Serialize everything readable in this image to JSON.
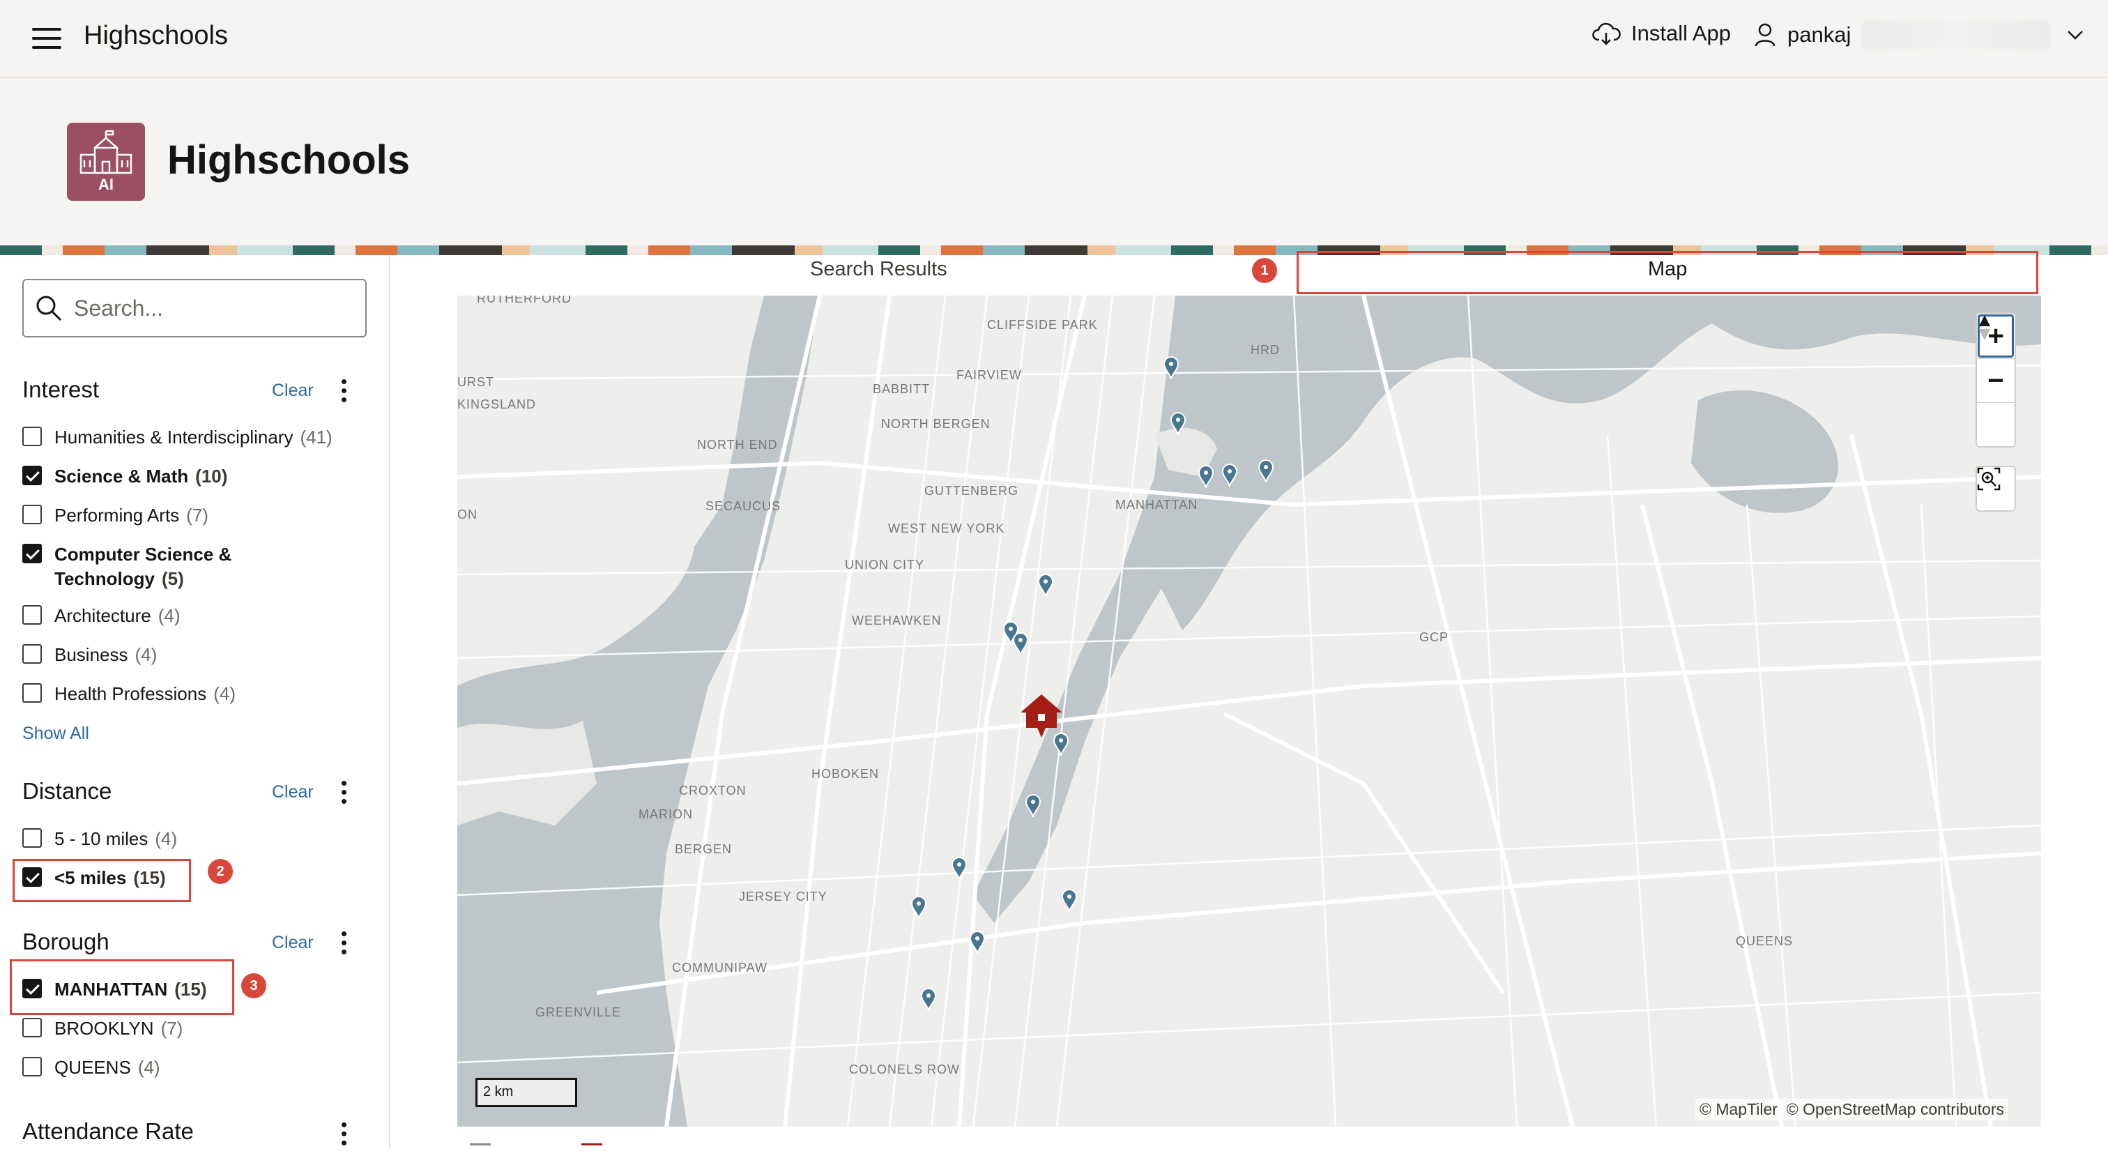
{
  "topbar": {
    "app_name": "Highschools",
    "install_label": "Install App",
    "user_name": "pankaj"
  },
  "header": {
    "title": "Highschools",
    "icon_text": "AI"
  },
  "sidebar": {
    "search_placeholder": "Search...",
    "interest": {
      "title": "Interest",
      "clear": "Clear",
      "options": [
        {
          "label": "Humanities & Interdisciplinary",
          "count": "(41)",
          "checked": false
        },
        {
          "label": "Science & Math",
          "count": "(10)",
          "checked": true
        },
        {
          "label": "Performing Arts",
          "count": "(7)",
          "checked": false
        },
        {
          "label": "Computer Science &",
          "label2": "Technology",
          "count": "(5)",
          "checked": true
        },
        {
          "label": "Architecture",
          "count": "(4)",
          "checked": false
        },
        {
          "label": "Business",
          "count": "(4)",
          "checked": false
        },
        {
          "label": "Health Professions",
          "count": "(4)",
          "checked": false
        }
      ],
      "show_all": "Show All"
    },
    "distance": {
      "title": "Distance",
      "clear": "Clear",
      "options": [
        {
          "label": "5 - 10 miles",
          "count": "(4)",
          "checked": false
        },
        {
          "label": "<5 miles",
          "count": "(15)",
          "checked": true
        }
      ]
    },
    "borough": {
      "title": "Borough",
      "clear": "Clear",
      "options": [
        {
          "label": "MANHATTAN",
          "count": "(15)",
          "checked": true
        },
        {
          "label": "BROOKLYN",
          "count": "(7)",
          "checked": false
        },
        {
          "label": "QUEENS",
          "count": "(4)",
          "checked": false
        }
      ]
    },
    "attendance": {
      "title": "Attendance Rate"
    }
  },
  "tabs": {
    "search_results": "Search Results",
    "map": "Map"
  },
  "callouts": [
    "1",
    "2",
    "3"
  ],
  "map": {
    "labels": [
      "RUTHERFORD",
      "CLIFFSIDE PARK",
      "FAIRVIEW",
      "BABBITT",
      "NORTH BERGEN",
      "NORTH END",
      "GUTTENBERG",
      "SECAUCUS",
      "WEST NEW YORK",
      "MANHATTAN",
      "UNION CITY",
      "WEEHAWKEN",
      "HOBOKEN",
      "CROXTON",
      "MARION",
      "BERGEN",
      "JERSEY CITY",
      "COMMUNIPAW",
      "GREENVILLE",
      "COLONELS ROW",
      "QUEENS",
      "HRD",
      "GCP",
      "KINGSLAND",
      "URST",
      "ON"
    ],
    "scale": "2 km",
    "attribution_1": "© MapTiler",
    "attribution_2": "© OpenStreetMap contributors",
    "zoom_in": "+",
    "zoom_out": "−"
  },
  "colors": {
    "accent_red": "#d9473b",
    "link_blue": "#2c6a9d",
    "pin_teal": "#4a7790",
    "home_red": "#a31f16",
    "app_icon": "#9c4e63"
  }
}
